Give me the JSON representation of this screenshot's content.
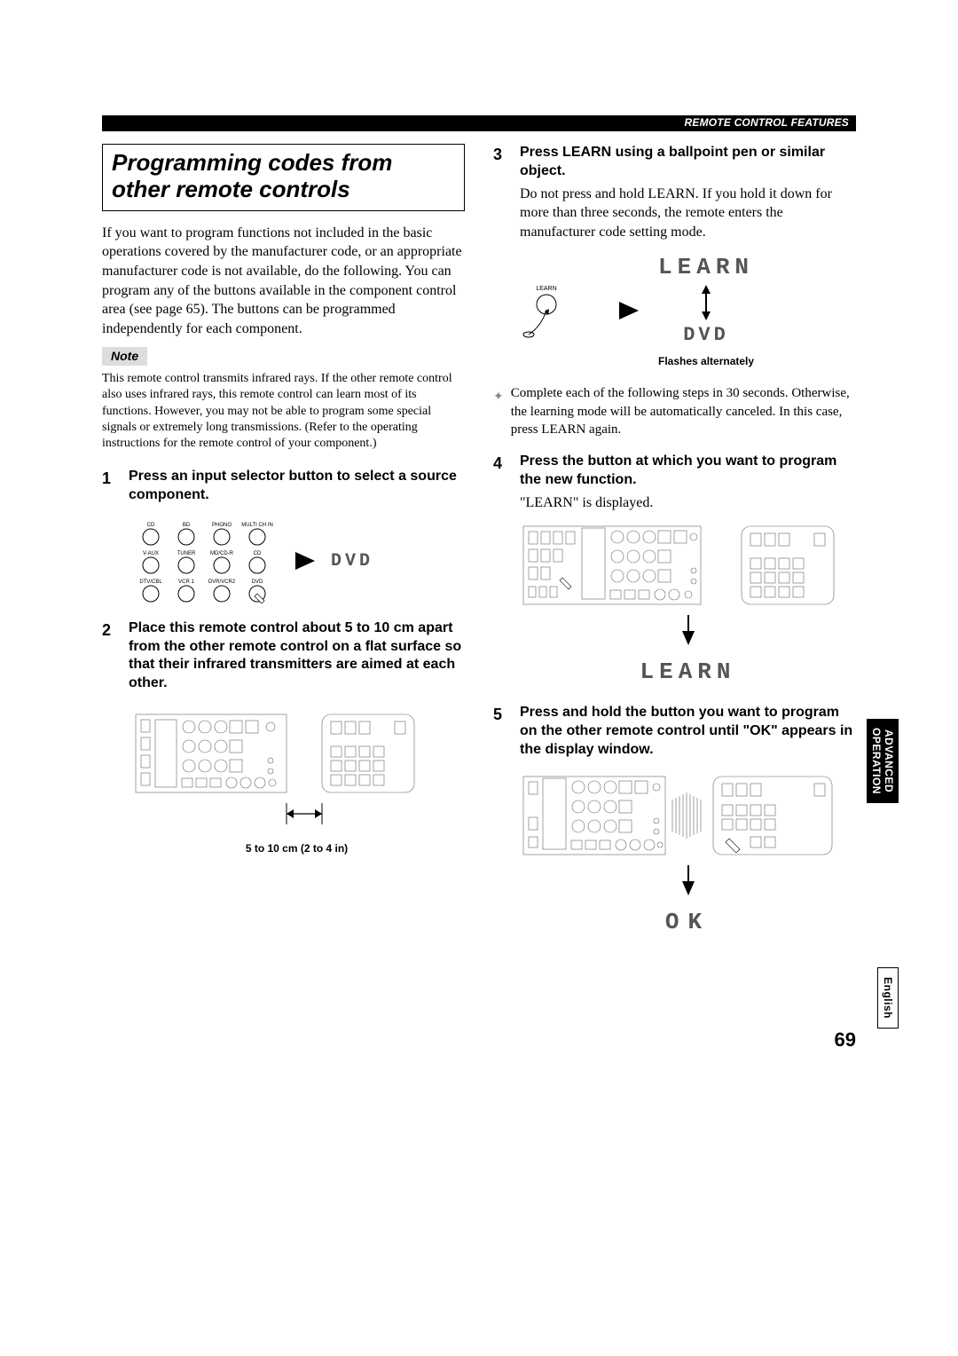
{
  "header": {
    "section": "REMOTE CONTROL FEATURES"
  },
  "title": "Programming codes from other remote controls",
  "intro": "If you want to program functions not included in the basic operations covered by the manufacturer code, or an appropriate manufacturer code is not available, do the following. You can program any of the buttons available in the component control area (see page 65). The buttons can be programmed independently for each component.",
  "note": {
    "label": "Note",
    "text": "This remote control transmits infrared rays. If the other remote control also uses infrared rays, this remote control can learn most of its functions. However, you may not be able to program some special signals or extremely long transmissions. (Refer to the operating instructions for the remote control of your component.)"
  },
  "steps": {
    "s1": {
      "num": "1",
      "heading": "Press an input selector button to select a source component."
    },
    "s2": {
      "num": "2",
      "heading": "Place this remote control about 5 to 10 cm apart from the other remote control on a flat surface so that their infrared transmitters are aimed at each other."
    },
    "s3": {
      "num": "3",
      "heading": "Press LEARN using a ballpoint pen or similar object.",
      "text": "Do not press and hold LEARN. If you hold it down for more than three seconds, the remote enters the manufacturer code setting mode."
    },
    "s4": {
      "num": "4",
      "heading": "Press the button at which you want to program the new function.",
      "text": "\"LEARN\" is displayed."
    },
    "s5": {
      "num": "5",
      "heading": "Press and hold the button you want to program on the other remote control until \"OK\" appears in the display window."
    }
  },
  "captions": {
    "distance": "5 to 10 cm (2 to 4 in)",
    "flashes": "Flashes alternately"
  },
  "hint": "Complete each of the following steps in 30 seconds. Otherwise, the learning mode will be automatically canceled. In this case, press LEARN again.",
  "lcd": {
    "dvd": "DVD",
    "learn": "LEARN",
    "ok": "OK"
  },
  "buttons": {
    "row1": [
      "CD",
      "BD",
      "PHONO",
      "MULTI CH IN"
    ],
    "row2": [
      "V-AUX",
      "TUNER",
      "MD/CD-R",
      "CD"
    ],
    "row3": [
      "DTV/CBL",
      "VCR 1",
      "DVR/VCR2",
      "DVD"
    ]
  },
  "learn_label": "LEARN",
  "tabs": {
    "advanced": "ADVANCED\nOPERATION",
    "english": "English"
  },
  "page_number": "69"
}
